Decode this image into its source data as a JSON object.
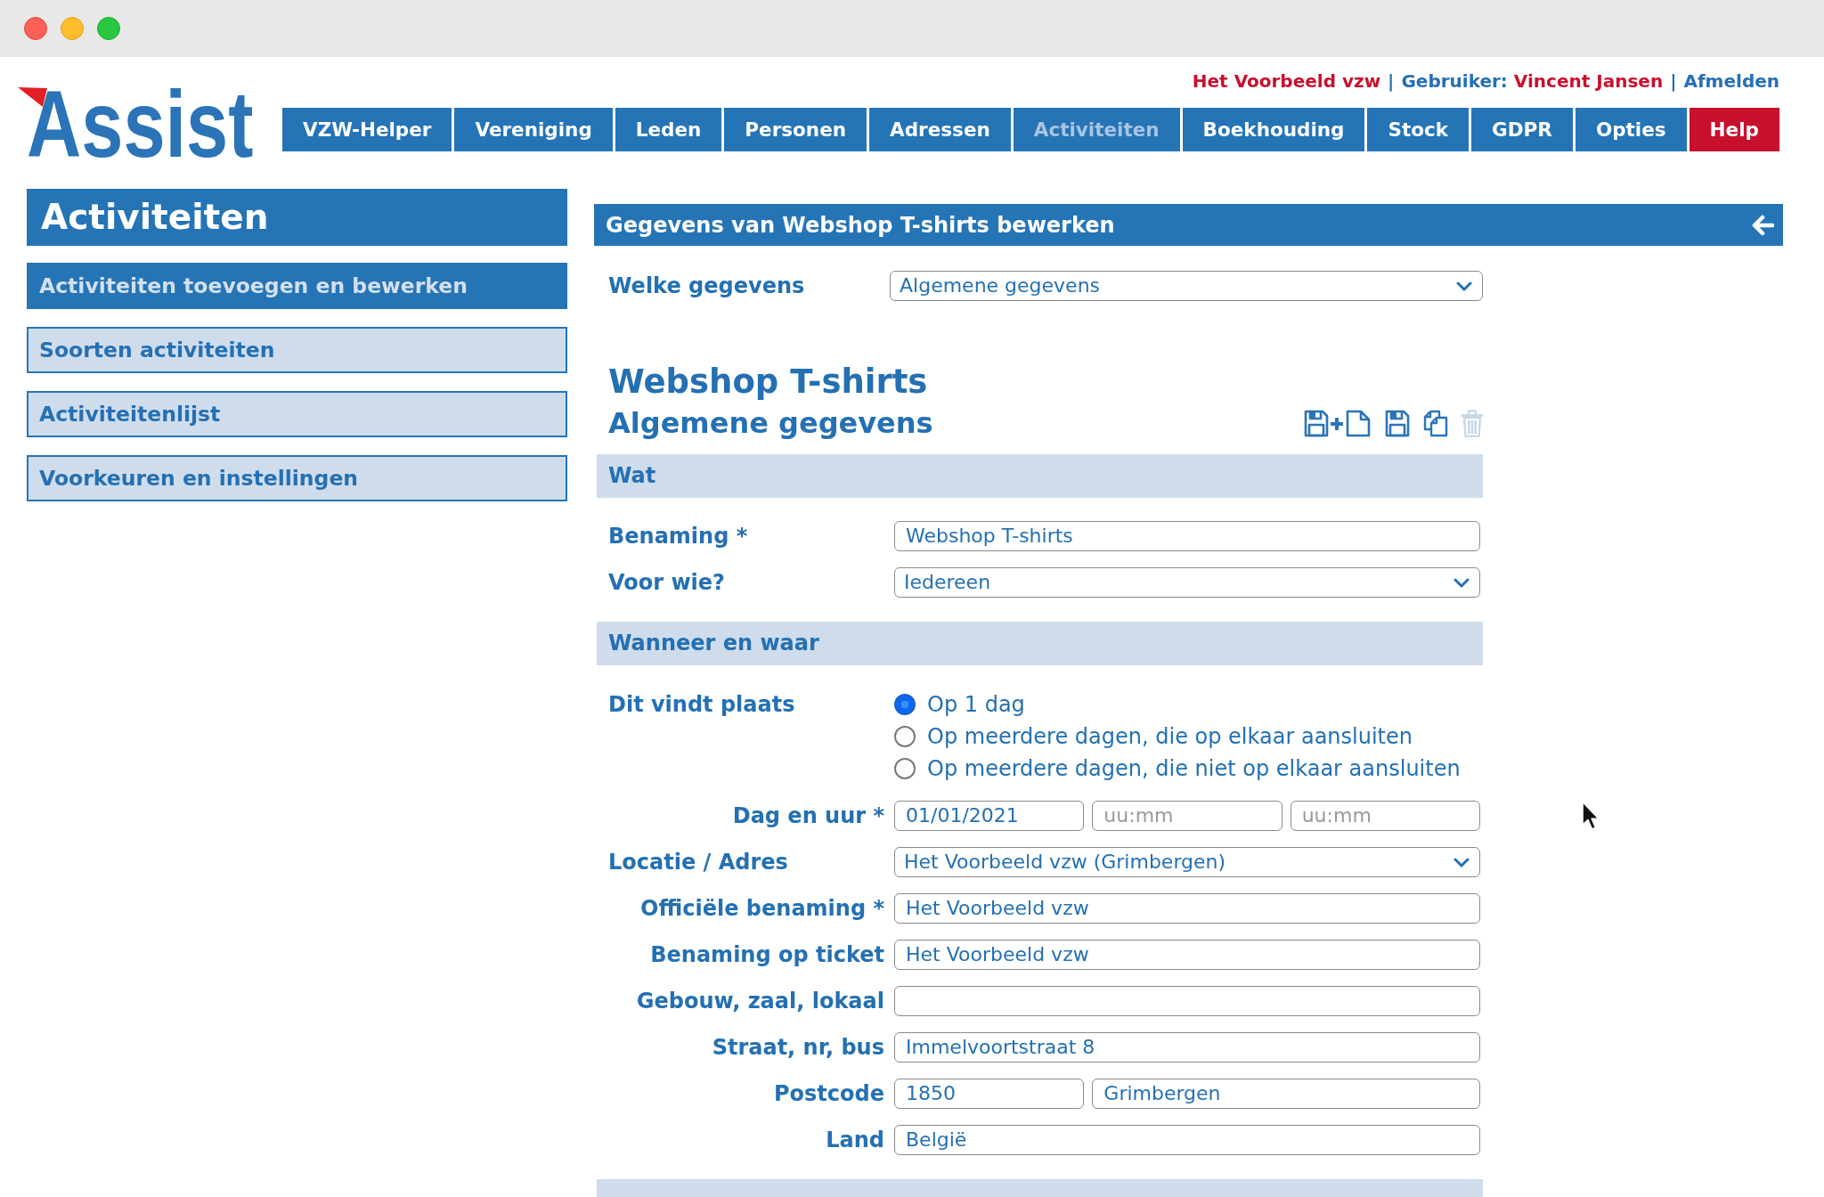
{
  "header": {
    "logo": "Assist",
    "account_bar": [
      {
        "kind": "organization",
        "text": "Het Voorbeeld vzw"
      },
      {
        "kind": "separator",
        "text": "|"
      },
      {
        "kind": "user",
        "label": "Gebruiker:",
        "name": "Vincent Jansen"
      },
      {
        "kind": "separator",
        "text": "|"
      },
      {
        "kind": "link",
        "text": "Afmelden"
      }
    ],
    "nav": [
      {
        "label": "VZW-Helper",
        "selected": false,
        "kind": "menu"
      },
      {
        "label": "Vereniging",
        "selected": false,
        "kind": "menu"
      },
      {
        "label": "Leden",
        "selected": false,
        "kind": "menu"
      },
      {
        "label": "Personen",
        "selected": false,
        "kind": "menu"
      },
      {
        "label": "Adressen",
        "selected": false,
        "kind": "menu"
      },
      {
        "label": "Activiteiten",
        "selected": true,
        "kind": "menu"
      },
      {
        "label": "Boekhouding",
        "selected": false,
        "kind": "menu"
      },
      {
        "label": "Stock",
        "selected": false,
        "kind": "menu"
      },
      {
        "label": "GDPR",
        "selected": false,
        "kind": "menu"
      },
      {
        "label": "Opties",
        "selected": false,
        "kind": "menu"
      },
      {
        "label": "Help",
        "selected": false,
        "kind": "help"
      }
    ]
  },
  "sidebar": {
    "title": "Activiteiten",
    "items": [
      {
        "label": "Activiteiten toevoegen en bewerken",
        "selected": true
      },
      {
        "label": "Soorten activiteiten",
        "selected": false
      },
      {
        "label": "Activiteitenlijst",
        "selected": false
      },
      {
        "label": "Voorkeuren en instellingen",
        "selected": false
      }
    ]
  },
  "panel": {
    "title": "Gegevens van Webshop T-shirts bewerken",
    "selector": {
      "label": "Welke gegevens",
      "value": "Algemene gegevens"
    },
    "record_title": "Webshop T-shirts",
    "record_subtitle": "Algemene gegevens",
    "toolbar": [
      {
        "kind": "save_new",
        "disabled": false
      },
      {
        "kind": "save",
        "disabled": false
      },
      {
        "kind": "copy",
        "disabled": false
      },
      {
        "kind": "delete",
        "disabled": true
      }
    ],
    "sections": [
      {
        "kind": "open",
        "title": "Wat",
        "fields": [
          {
            "kind": "text",
            "label": "Benaming *",
            "right_aligned": false,
            "value": "Webshop T-shirts"
          },
          {
            "kind": "select",
            "label": "Voor wie?",
            "right_aligned": false,
            "value": "Iedereen"
          }
        ]
      },
      {
        "kind": "open",
        "title": "Wanneer en waar",
        "fields": [
          {
            "kind": "radio",
            "label": "Dit vindt plaats",
            "right_aligned": false,
            "options": [
              {
                "label": "Op 1 dag",
                "selected": true
              },
              {
                "label": "Op meerdere dagen, die op elkaar aansluiten",
                "selected": false
              },
              {
                "label": "Op meerdere dagen, die niet op elkaar aansluiten",
                "selected": false
              }
            ]
          },
          {
            "kind": "split",
            "label": "Dag en uur *",
            "right_aligned": true,
            "parts": [
              {
                "value": "01/01/2021"
              },
              {
                "placeholder": "uu:mm"
              },
              {
                "placeholder": "uu:mm"
              }
            ]
          },
          {
            "kind": "select",
            "label": "Locatie / Adres",
            "right_aligned": false,
            "value": "Het Voorbeeld vzw (Grimbergen)"
          },
          {
            "kind": "text",
            "label": "Officiële benaming *",
            "right_aligned": true,
            "value": "Het Voorbeeld vzw"
          },
          {
            "kind": "text",
            "label": "Benaming op ticket",
            "right_aligned": true,
            "value": "Het Voorbeeld vzw"
          },
          {
            "kind": "text",
            "label": "Gebouw, zaal, lokaal",
            "right_aligned": true
          },
          {
            "kind": "text",
            "label": "Straat, nr, bus",
            "right_aligned": true,
            "value": "Immelvoortstraat 8"
          },
          {
            "kind": "split",
            "label": "Postcode",
            "right_aligned": true,
            "parts": [
              {
                "value": "1850"
              },
              {
                "value": "Grimbergen"
              }
            ]
          },
          {
            "kind": "text",
            "label": "Land",
            "right_aligned": true,
            "value": "België"
          }
        ]
      },
      {
        "kind": "cut_off"
      }
    ]
  }
}
